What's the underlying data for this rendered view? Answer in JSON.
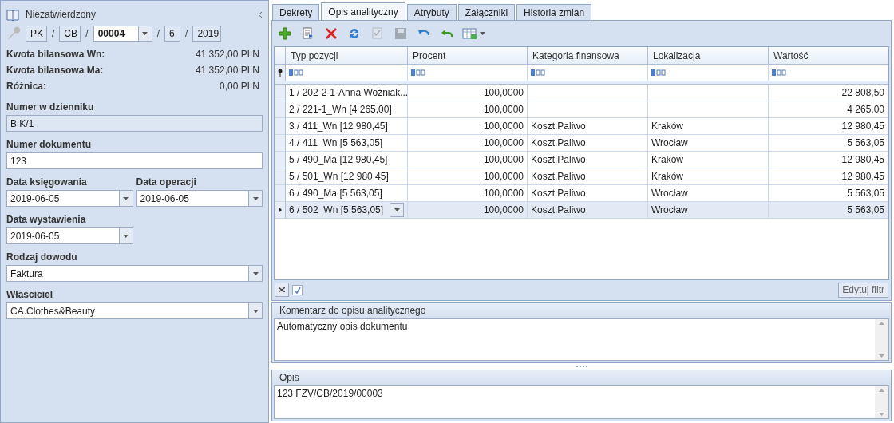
{
  "left_panel": {
    "status": "Niezatwierdzony",
    "number": {
      "separator": "/",
      "parts": [
        {
          "value": "PK",
          "kind": "box"
        },
        {
          "value": "CB",
          "kind": "box"
        },
        {
          "value": "00004",
          "kind": "dropdown"
        },
        {
          "value": "6",
          "kind": "box"
        },
        {
          "value": "2019",
          "kind": "box"
        }
      ]
    },
    "summary": [
      {
        "label": "Kwota bilansowa Wn:",
        "value": "41 352,00 PLN"
      },
      {
        "label": "Kwota bilansowa Ma:",
        "value": "41 352,00 PLN"
      },
      {
        "label": "Różnica:",
        "value": "0,00 PLN"
      }
    ],
    "field_rows": [
      [
        {
          "label": "Numer w dzienniku",
          "value": "B K/1",
          "kind": "readonly"
        }
      ],
      [
        {
          "label": "Numer dokumentu",
          "value": "123",
          "kind": "text"
        }
      ],
      [
        {
          "label": "Data księgowania",
          "value": "2019-06-05",
          "kind": "date"
        },
        {
          "label": "Data operacji",
          "value": "2019-06-05",
          "kind": "date"
        }
      ],
      [
        {
          "label": "Data wystawienia",
          "value": "2019-06-05",
          "kind": "date"
        }
      ],
      [
        {
          "label": "Rodzaj dowodu",
          "value": "Faktura",
          "kind": "dropdown"
        }
      ],
      [
        {
          "label": "Właściciel",
          "value": "CA.Clothes&Beauty",
          "kind": "dropdown"
        }
      ]
    ]
  },
  "tabs": [
    {
      "label": "Dekrety",
      "selected": false
    },
    {
      "label": "Opis analityczny",
      "selected": true
    },
    {
      "label": "Atrybuty",
      "selected": false
    },
    {
      "label": "Załączniki",
      "selected": false
    },
    {
      "label": "Historia zmian",
      "selected": false
    }
  ],
  "toolbar": [
    {
      "kind": "add",
      "disabled": false
    },
    {
      "kind": "copy",
      "disabled": false
    },
    {
      "kind": "delete",
      "disabled": false
    },
    {
      "kind": "refresh",
      "disabled": false
    },
    {
      "kind": "approve",
      "disabled": true
    },
    {
      "kind": "save",
      "disabled": true
    },
    {
      "kind": "undo",
      "disabled": false
    },
    {
      "kind": "back",
      "disabled": false
    },
    {
      "kind": "export",
      "disabled": false
    }
  ],
  "table": {
    "columns": [
      {
        "label": "Typ pozycji"
      },
      {
        "label": "Procent"
      },
      {
        "label": "Kategoria finansowa"
      },
      {
        "label": "Lokalizacja"
      },
      {
        "label": "Wartość"
      }
    ],
    "rows": [
      {
        "selected": false,
        "cells": [
          "1 / 202-2-1-Anna Woźniak...",
          "100,0000",
          "",
          "",
          "22 808,50"
        ]
      },
      {
        "selected": false,
        "cells": [
          "2 / 221-1_Wn [4 265,00]",
          "100,0000",
          "",
          "",
          "4 265,00"
        ]
      },
      {
        "selected": false,
        "cells": [
          "3 / 411_Wn [12 980,45]",
          "100,0000",
          "Koszt.Paliwo",
          "Kraków",
          "12 980,45"
        ]
      },
      {
        "selected": false,
        "cells": [
          "4 / 411_Wn [5 563,05]",
          "100,0000",
          "Koszt.Paliwo",
          "Wrocław",
          "5 563,05"
        ]
      },
      {
        "selected": false,
        "cells": [
          "5 / 490_Ma [12 980,45]",
          "100,0000",
          "Koszt.Paliwo",
          "Kraków",
          "12 980,45"
        ]
      },
      {
        "selected": false,
        "cells": [
          "5 / 501_Wn [12 980,45]",
          "100,0000",
          "Koszt.Paliwo",
          "Kraków",
          "12 980,45"
        ]
      },
      {
        "selected": false,
        "cells": [
          "6 / 490_Ma [5 563,05]",
          "100,0000",
          "Koszt.Paliwo",
          "Wrocław",
          "5 563,05"
        ]
      },
      {
        "selected": true,
        "cells": [
          "6 / 502_Wn [5 563,05]",
          "100,0000",
          "Koszt.Paliwo",
          "Wrocław",
          "5 563,05"
        ]
      }
    ],
    "filter_enabled": true,
    "edit_filter_button": "Edytuj filtr"
  },
  "comment": {
    "title": "Komentarz do opisu analitycznego",
    "value": "Automatyczny opis dokumentu"
  },
  "description": {
    "title": "Opis",
    "value": "123 FZV/CB/2019/00003"
  }
}
